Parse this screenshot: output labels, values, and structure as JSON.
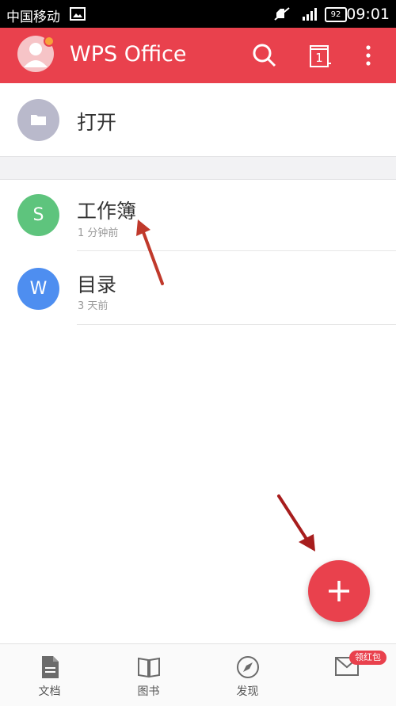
{
  "status_bar": {
    "carrier": "中国移动",
    "battery": "92",
    "time": "09:01"
  },
  "app_bar": {
    "title": "WPS Office",
    "tab_count": "1"
  },
  "open_row": {
    "label": "打开"
  },
  "recent": [
    {
      "name": "工作簿",
      "time": "1 分钟前",
      "icon_letter": "S",
      "icon_color": "#5ec47d"
    },
    {
      "name": "目录",
      "time": "3 天前",
      "icon_letter": "W",
      "icon_color": "#4e8ef0"
    }
  ],
  "bottom_tabs": [
    {
      "label": "文档",
      "icon": "document-icon"
    },
    {
      "label": "图书",
      "icon": "book-icon"
    },
    {
      "label": "发现",
      "icon": "compass-icon"
    },
    {
      "label": "",
      "icon": "envelope-icon"
    }
  ],
  "badge": {
    "text": "领红包"
  },
  "colors": {
    "brand": "#e9414d",
    "folder": "#b9b9cb"
  }
}
